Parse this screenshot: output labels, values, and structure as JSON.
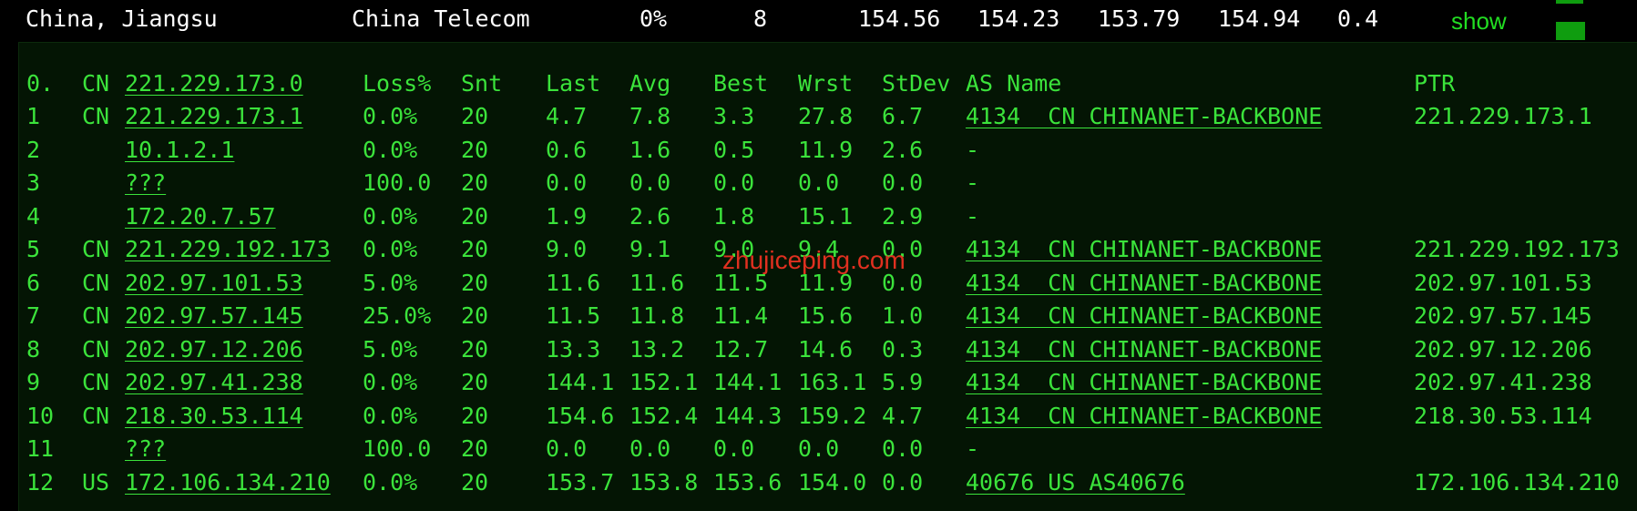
{
  "summary": {
    "location": "China, Jiangsu",
    "isp": "China Telecom",
    "loss": "0%",
    "count": "8",
    "v1": "154.56",
    "v2": "154.23",
    "v3": "153.79",
    "v4": "154.94",
    "v5": "0.4",
    "show_label": "show"
  },
  "columns": {
    "index": "0.",
    "country": "CN",
    "host": "221.229.173.0",
    "loss": "Loss%",
    "snt": "Snt",
    "last": "Last",
    "avg": "Avg",
    "best": "Best",
    "wrst": "Wrst",
    "stdev": "StDev",
    "as_name": "AS Name",
    "ptr": "PTR"
  },
  "rows": [
    {
      "index": "1",
      "country": "CN",
      "host": "221.229.173.1",
      "loss": "0.0%",
      "snt": "20",
      "last": "4.7",
      "avg": "7.8",
      "best": "3.3",
      "wrst": "27.8",
      "stdev": "6.7",
      "as_name": "4134  CN CHINANET-BACKBONE",
      "ptr": "221.229.173.1"
    },
    {
      "index": "2",
      "country": "",
      "host": "10.1.2.1",
      "loss": "0.0%",
      "snt": "20",
      "last": "0.6",
      "avg": "1.6",
      "best": "0.5",
      "wrst": "11.9",
      "stdev": "2.6",
      "as_name": "-",
      "ptr": ""
    },
    {
      "index": "3",
      "country": "",
      "host": "???",
      "loss": "100.0",
      "snt": "20",
      "last": "0.0",
      "avg": "0.0",
      "best": "0.0",
      "wrst": "0.0",
      "stdev": "0.0",
      "as_name": "-",
      "ptr": ""
    },
    {
      "index": "4",
      "country": "",
      "host": "172.20.7.57",
      "loss": "0.0%",
      "snt": "20",
      "last": "1.9",
      "avg": "2.6",
      "best": "1.8",
      "wrst": "15.1",
      "stdev": "2.9",
      "as_name": "-",
      "ptr": ""
    },
    {
      "index": "5",
      "country": "CN",
      "host": "221.229.192.173",
      "loss": "0.0%",
      "snt": "20",
      "last": "9.0",
      "avg": "9.1",
      "best": "9.0",
      "wrst": "9.4",
      "stdev": "0.0",
      "as_name": "4134  CN CHINANET-BACKBONE",
      "ptr": "221.229.192.173"
    },
    {
      "index": "6",
      "country": "CN",
      "host": "202.97.101.53",
      "loss": "5.0%",
      "snt": "20",
      "last": "11.6",
      "avg": "11.6",
      "best": "11.5",
      "wrst": "11.9",
      "stdev": "0.0",
      "as_name": "4134  CN CHINANET-BACKBONE",
      "ptr": "202.97.101.53"
    },
    {
      "index": "7",
      "country": "CN",
      "host": "202.97.57.145",
      "loss": "25.0%",
      "snt": "20",
      "last": "11.5",
      "avg": "11.8",
      "best": "11.4",
      "wrst": "15.6",
      "stdev": "1.0",
      "as_name": "4134  CN CHINANET-BACKBONE",
      "ptr": "202.97.57.145"
    },
    {
      "index": "8",
      "country": "CN",
      "host": "202.97.12.206",
      "loss": "5.0%",
      "snt": "20",
      "last": "13.3",
      "avg": "13.2",
      "best": "12.7",
      "wrst": "14.6",
      "stdev": "0.3",
      "as_name": "4134  CN CHINANET-BACKBONE",
      "ptr": "202.97.12.206"
    },
    {
      "index": "9",
      "country": "CN",
      "host": "202.97.41.238",
      "loss": "0.0%",
      "snt": "20",
      "last": "144.1",
      "avg": "152.1",
      "best": "144.1",
      "wrst": "163.1",
      "stdev": "5.9",
      "as_name": "4134  CN CHINANET-BACKBONE",
      "ptr": "202.97.41.238"
    },
    {
      "index": "10",
      "country": "CN",
      "host": "218.30.53.114",
      "loss": "0.0%",
      "snt": "20",
      "last": "154.6",
      "avg": "152.4",
      "best": "144.3",
      "wrst": "159.2",
      "stdev": "4.7",
      "as_name": "4134  CN CHINANET-BACKBONE",
      "ptr": "218.30.53.114"
    },
    {
      "index": "11",
      "country": "",
      "host": "???",
      "loss": "100.0",
      "snt": "20",
      "last": "0.0",
      "avg": "0.0",
      "best": "0.0",
      "wrst": "0.0",
      "stdev": "0.0",
      "as_name": "-",
      "ptr": ""
    },
    {
      "index": "12",
      "country": "US",
      "host": "172.106.134.210",
      "loss": "0.0%",
      "snt": "20",
      "last": "153.7",
      "avg": "153.8",
      "best": "153.6",
      "wrst": "154.0",
      "stdev": "0.0",
      "as_name": "40676 US AS40676",
      "ptr": "172.106.134.210"
    }
  ],
  "watermark": "zhujiceping.com",
  "colors": {
    "terminal_text": "#3be33b",
    "background": "#000000",
    "panel": "#041504",
    "header_text": "#ffffff",
    "watermark": "#e03020",
    "legend_square": "#0f9d0f"
  }
}
